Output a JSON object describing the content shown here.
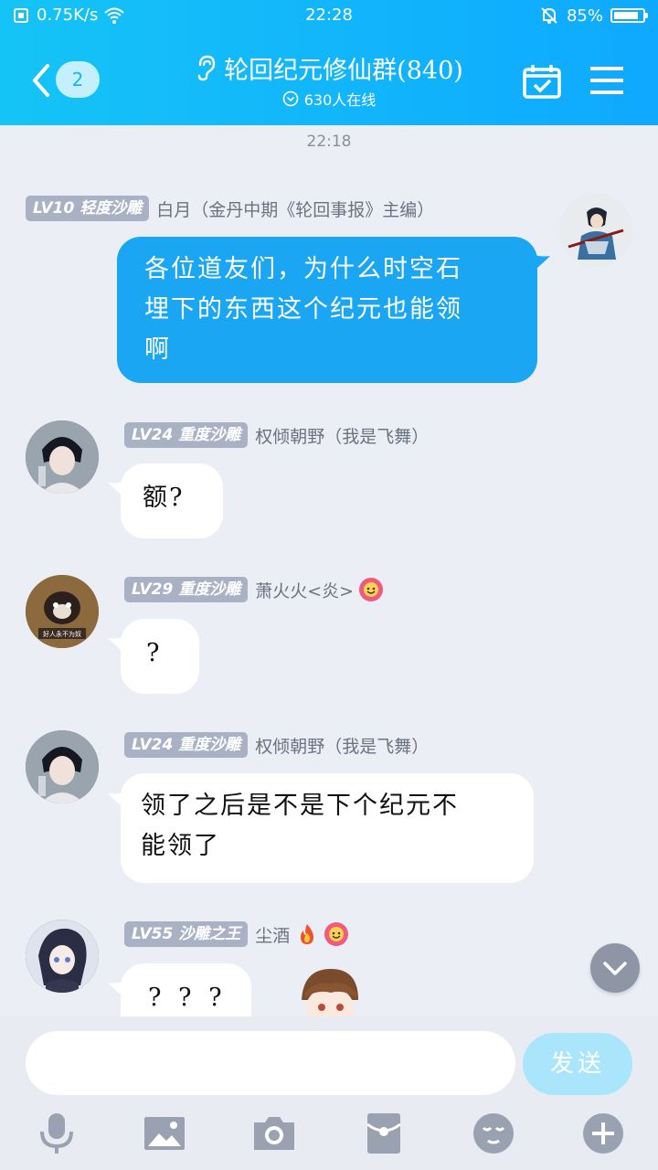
{
  "status_bar": {
    "net_speed": "0.75K/s",
    "time": "22:28",
    "battery": "85%",
    "battery_level": 0.85
  },
  "header": {
    "unread_count": "2",
    "title": "轮回纪元修仙群(840)",
    "online": "630人在线"
  },
  "chat": {
    "timestamp": "22:18",
    "messages": [
      {
        "level": "LV10 轻度沙雕",
        "name": "白月（金丹中期《轮回事报》主编）",
        "text": "各位道友们，为什么时空石埋下的东西这个纪元也能领啊",
        "line1": "各位道友们，为什么时空石",
        "line2": "埋下的东西这个纪元也能领",
        "line3": "啊"
      },
      {
        "level": "LV24 重度沙雕",
        "name": "权倾朝野（我是飞舞）",
        "text": "额?"
      },
      {
        "level": "LV29 重度沙雕",
        "name": "萧火火<炎>",
        "text": "?",
        "avatar_caption": "好人永不为奴"
      },
      {
        "level": "LV24 重度沙雕",
        "name": "权倾朝野（我是飞舞）",
        "text": "领了之后是不是下个纪元不能领了",
        "line1": "领了之后是不是下个纪元不",
        "line2": "能领了"
      },
      {
        "level": "LV55 沙雕之王",
        "name": "尘酒",
        "text": "? ? ?"
      }
    ]
  },
  "composer": {
    "input_value": "",
    "send_label": "发送"
  },
  "icons": {
    "mic": "microphone-icon",
    "image": "image-icon",
    "camera": "camera-icon",
    "red_packet": "red-packet-icon",
    "emoji": "emoji-icon",
    "plus": "plus-icon"
  },
  "colors": {
    "header_blue": "#12b6fb",
    "outgoing_bubble": "#1aa6f2",
    "level_badge": "#a9b1c4",
    "send_button": "#a9e6fb"
  }
}
